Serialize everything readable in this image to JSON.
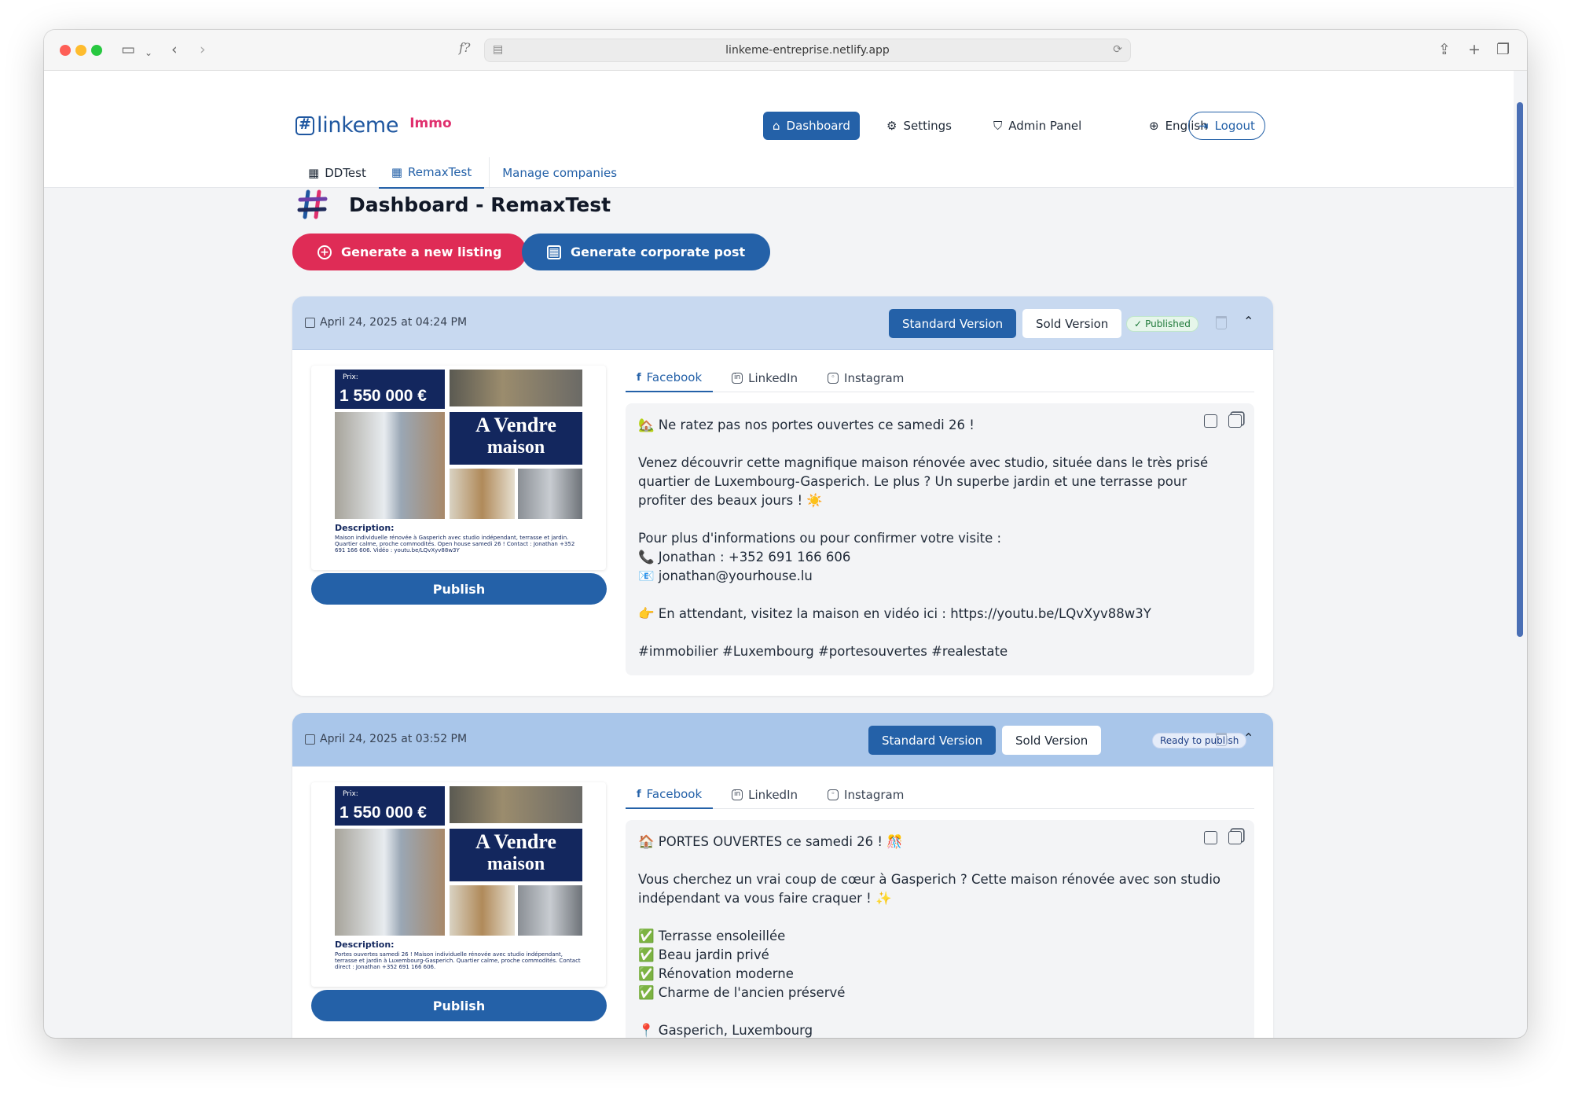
{
  "browser": {
    "url": "linkeme-entreprise.netlify.app",
    "reader_icon": "f?"
  },
  "app": {
    "brand": "linkeme",
    "brand_sub": "Immo",
    "nav": {
      "dashboard": "Dashboard",
      "settings": "Settings",
      "admin": "Admin Panel",
      "language": "English",
      "logout": "Logout"
    },
    "company_tabs": [
      "DDTest",
      "RemaxTest"
    ],
    "manage_companies": "Manage companies"
  },
  "main": {
    "title": "Dashboard - RemaxTest",
    "generate_listing": "Generate a new listing",
    "generate_corporate": "Generate corporate post"
  },
  "cards": [
    {
      "date": "April 24, 2025 at 04:24 PM",
      "standard_label": "Standard Version",
      "sold_label": "Sold Version",
      "status": "Published",
      "image": {
        "price_label": "Prix:",
        "price": "1 550 000 €",
        "sale_line1": "A Vendre",
        "sale_line2": "maison",
        "desc_title": "Description:",
        "desc": "Maison individuelle rénovée à Gasperich avec studio indépendant, terrasse et jardin. Quartier calme, proche commodités. Open house samedi 26 ! Contact : Jonathan +352 691 166 606. Vidéo : youtu.be/LQvXyv88w3Y"
      },
      "publish_label": "Publish",
      "social_tabs": [
        "Facebook",
        "LinkedIn",
        "Instagram"
      ],
      "post_lines": [
        "🏡 Ne ratez pas nos portes ouvertes ce samedi 26 !",
        "",
        "Venez découvrir cette magnifique maison rénovée avec studio, située dans le très prisé quartier de Luxembourg-Gasperich. Le plus ? Un superbe jardin et une terrasse pour profiter des beaux jours ! ☀️",
        "",
        "Pour plus d'informations ou pour confirmer votre visite :",
        "📞 Jonathan : +352 691 166 606",
        "📧 jonathan@yourhouse.lu",
        "",
        "👉 En attendant, visitez la maison en vidéo ici : https://youtu.be/LQvXyv88w3Y",
        "",
        "#immobilier #Luxembourg #portesouvertes #realestate"
      ]
    },
    {
      "date": "April 24, 2025 at 03:52 PM",
      "standard_label": "Standard Version",
      "sold_label": "Sold Version",
      "status": "Ready to publish",
      "image": {
        "price_label": "Prix:",
        "price": "1 550 000 €",
        "sale_line1": "A Vendre",
        "sale_line2": "maison",
        "desc_title": "Description:",
        "desc": "Portes ouvertes samedi 26 ! Maison individuelle rénovée avec studio indépendant, terrasse et jardin à Luxembourg-Gasperich. Quartier calme, proche commodités. Contact direct : Jonathan +352 691 166 606."
      },
      "publish_label": "Publish",
      "social_tabs": [
        "Facebook",
        "LinkedIn",
        "Instagram"
      ],
      "post_lines": [
        "🏠 PORTES OUVERTES ce samedi 26 ! 🎊",
        "",
        "Vous cherchez un vrai coup de cœur à Gasperich ? Cette maison rénovée avec son studio indépendant va vous faire craquer ! ✨",
        "",
        "✅ Terrasse ensoleillée",
        "✅ Beau jardin privé",
        "✅ Rénovation moderne",
        "✅ Charme de l'ancien préservé",
        "",
        "📍 Gasperich, Luxembourg"
      ]
    }
  ],
  "colors": {
    "primary": "#2461a8",
    "accent": "#df2c56",
    "card_header": "#c8d9f0"
  }
}
